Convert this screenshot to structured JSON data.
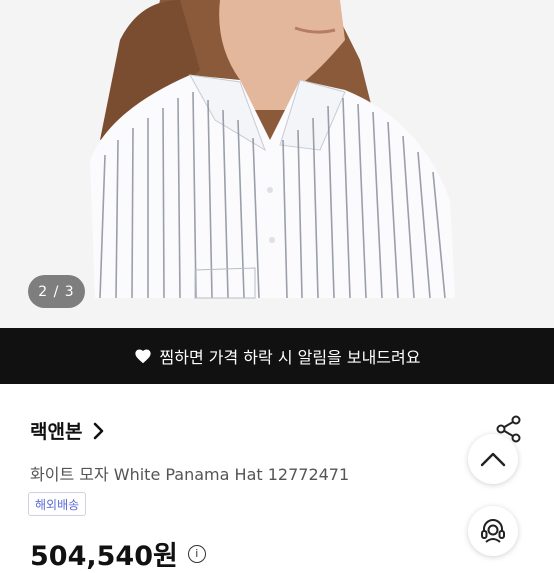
{
  "gallery": {
    "page_indicator": "2 / 3",
    "image_alt": "product-photo-striped-shirt"
  },
  "wishlist_banner": {
    "text": "찜하면 가격 하락 시 알림을 보내드려요",
    "icon": "heart-icon"
  },
  "store": {
    "name": "랙앤본"
  },
  "product": {
    "title": "화이트 모자 White Panama Hat 12772471",
    "tag": "해외배송",
    "price": "504,540원",
    "price_info": "i"
  },
  "colors": {
    "banner_bg": "#111111",
    "tag_text": "#5b6cd6"
  }
}
